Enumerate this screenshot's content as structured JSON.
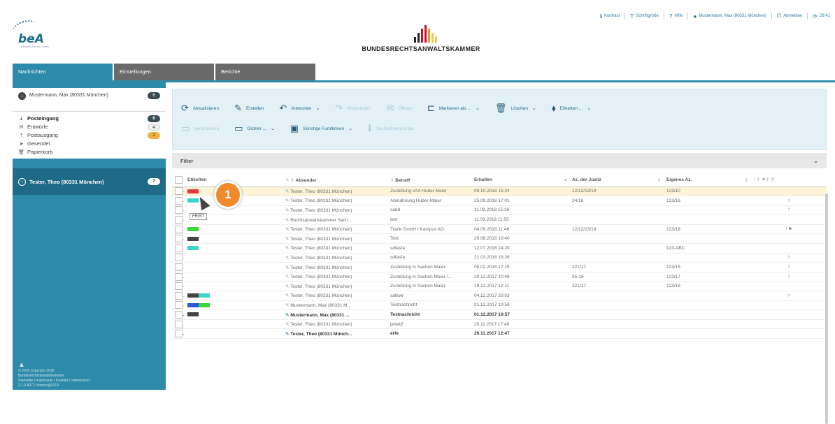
{
  "colors": {
    "accent": "#2d8aa8",
    "sidebar": "#2d8aa8",
    "highlight": "#fdf4d8",
    "marker": "#f08a2a"
  },
  "brand": {
    "logo_text": "beA",
    "logo_sub": "Beispiel Kanzlei Daten",
    "name": "BUNDESRECHTSANWALTSKAMMER"
  },
  "topbar": [
    {
      "icon": "info-icon",
      "label": "Kontrast"
    },
    {
      "icon": "font-size-icon",
      "label": "Schriftgröße"
    },
    {
      "icon": "help-icon",
      "label": "Hilfe"
    },
    {
      "icon": "user-icon",
      "label": "Mustermann, Max (80331 München)"
    },
    {
      "icon": "power-icon",
      "label": "Abmelden"
    },
    {
      "icon": "refresh-icon",
      "label": "29:41"
    }
  ],
  "tabs": [
    "Nachrichten",
    "Einstellungen",
    "Berichte"
  ],
  "sidebar": {
    "account1": {
      "name": "Mustermann, Max (80331 München)",
      "count": "6"
    },
    "folders": [
      {
        "icon": "inbox-icon",
        "label": "Posteingang",
        "count": "6"
      },
      {
        "icon": "drafts-icon",
        "label": "Entwürfe",
        "count": "4"
      },
      {
        "icon": "outbox-icon",
        "label": "Postausgang",
        "count": "1"
      },
      {
        "icon": "sent-icon",
        "label": "Gesendet",
        "count": ""
      },
      {
        "icon": "trash-icon",
        "label": "Papierkorb",
        "count": ""
      }
    ],
    "account2": {
      "name": "Tester, Theo (80331 München)",
      "count": "7"
    },
    "footer": [
      "© 2018 Copyright 2018",
      "Bundesrechtsanwaltskammer",
      "Startseite | Impressum | Kontakt | Datenschutz",
      "2.1.0.8072 Version@2019"
    ]
  },
  "toolbar": {
    "row1": [
      {
        "icon": "refresh-icon",
        "label": "Aktualisieren",
        "dropdown": false,
        "disabled": false
      },
      {
        "icon": "pencil-icon",
        "label": "Erstellen",
        "dropdown": false,
        "disabled": false
      },
      {
        "icon": "reply-icon",
        "label": "Antworten",
        "dropdown": true,
        "disabled": false
      },
      {
        "icon": "forward-icon",
        "label": "Weiterleiten",
        "dropdown": false,
        "disabled": true
      },
      {
        "icon": "envelope-icon",
        "label": "Öffnen",
        "dropdown": false,
        "disabled": true
      },
      {
        "icon": "bookmark-icon",
        "label": "Markieren als ...",
        "dropdown": true,
        "disabled": false
      },
      {
        "icon": "trash-icon",
        "label": "Löschen",
        "dropdown": true,
        "disabled": false
      },
      {
        "icon": "tag-icon",
        "label": "Etiketten ...",
        "dropdown": true,
        "disabled": false
      }
    ],
    "row2": [
      {
        "icon": "folder-move-icon",
        "label": "Verschieben",
        "dropdown": false,
        "disabled": true
      },
      {
        "icon": "folder-icon",
        "label": "Ordner ...",
        "dropdown": true,
        "disabled": false
      },
      {
        "icon": "caret-box-icon",
        "label": "Sonstige Funktionen",
        "dropdown": true,
        "disabled": false
      },
      {
        "icon": "info-icon",
        "label": "Nachrichtenjournal",
        "dropdown": false,
        "disabled": true
      }
    ]
  },
  "filter": {
    "label": "Filter"
  },
  "table": {
    "headers": [
      "Etiketten",
      "Absender",
      "Betreff",
      "Erhalten",
      "Az. der Justiz",
      "Eigenes Az.",
      ""
    ],
    "rows": [
      {
        "tags": [
          "#e23a3a"
        ],
        "sender": "Tester, Theo (80331 München)",
        "subject": "Zustellung vAA Huber Meier",
        "received": "09.10.2018 15:24",
        "az_justiz": "12/12/13/19",
        "az_own": "123/10",
        "flags": "",
        "hl": true,
        "bold": false
      },
      {
        "tags": [
          "#3ad6c8"
        ],
        "sender": "Tester, Theo (80331 München)",
        "subject": "Abmahnung Huber-Maier",
        "received": "25.09.2018 17:01",
        "az_justiz": "34/16",
        "az_own": "123/16",
        "flags": "!",
        "hl": false,
        "bold": false
      },
      {
        "tags": [],
        "sender": "Tester, Theo (80331 München)",
        "subject": "sadd",
        "received": "11.09.2018 15:36",
        "az_justiz": "",
        "az_own": "",
        "flags": "!",
        "hl": false,
        "bold": false
      },
      {
        "tags": [],
        "sender": "Rechtsanwaltskammer Sach...",
        "subject": "test",
        "received": "11.09.2018 11:55",
        "az_justiz": "",
        "az_own": "",
        "flags": "",
        "hl": false,
        "bold": false
      },
      {
        "tags": [
          "#3cd63c"
        ],
        "sender": "Tester, Theo (80331 München)",
        "subject": "Trank GmbH / Kampus AG",
        "received": "04.09.2018 11:48",
        "az_justiz": "12/12/13/18",
        "az_own": "123/18",
        "flags": "! ⚑",
        "hl": false,
        "bold": false
      },
      {
        "tags": [
          "#444444"
        ],
        "sender": "Tester, Theo (80331 München)",
        "subject": "Test",
        "received": "29.08.2018 10:40",
        "az_justiz": "",
        "az_own": "",
        "flags": "",
        "hl": false,
        "bold": false
      },
      {
        "tags": [
          "#3ad6c8"
        ],
        "sender": "Tester, Theo (80331 München)",
        "subject": "sdfasfa",
        "received": "12.07.2018 14:20",
        "az_justiz": "",
        "az_own": "123-ABC",
        "flags": "",
        "hl": false,
        "bold": false
      },
      {
        "tags": [],
        "sender": "Tester, Theo (80331 München)",
        "subject": "sdfasfa",
        "received": "21.03.2018 15:26",
        "az_justiz": "",
        "az_own": "",
        "flags": "!",
        "hl": false,
        "bold": false
      },
      {
        "tags": [],
        "sender": "Tester, Theo (80331 München)",
        "subject": "Zustellung in Sachen Maier",
        "received": "05.02.2018 17:15",
        "az_justiz": "321/17",
        "az_own": "123/15",
        "flags": "!",
        "hl": false,
        "bold": false
      },
      {
        "tags": [],
        "sender": "Tester, Theo (80331 München)",
        "subject": "Zustellung in Sachen Moier /...",
        "received": "29.12.2017 10:48",
        "az_justiz": "95-16",
        "az_own": "123/17",
        "flags": "!",
        "hl": false,
        "bold": false
      },
      {
        "tags": [],
        "sender": "Tester, Theo (80331 München)",
        "subject": "Zustellung in Sachen Maier",
        "received": "19.12.2017 12:11",
        "az_justiz": "321/17",
        "az_own": "123/18",
        "flags": "",
        "hl": false,
        "bold": false
      },
      {
        "tags": [
          "#444444",
          "#3ad6c8"
        ],
        "sender": "Tester, Theo (80331 München)",
        "subject": "safewr",
        "received": "04.12.2017 20:03",
        "az_justiz": "",
        "az_own": "",
        "flags": "!",
        "hl": false,
        "bold": false
      },
      {
        "tags": [
          "#2a5ad6",
          "#3cd63c"
        ],
        "sender": "Mustermann, Max (80331 M...",
        "subject": "Testnachricht",
        "received": "01.12.2017 10:58",
        "az_justiz": "",
        "az_own": "",
        "flags": "",
        "hl": false,
        "bold": false
      },
      {
        "tags": [
          "#444444"
        ],
        "sender": "Mustermann, Max (80331 ...",
        "subject": "Testnachricht",
        "received": "01.12.2017 10:57",
        "az_justiz": "",
        "az_own": "",
        "flags": "",
        "hl": false,
        "bold": true
      },
      {
        "tags": [],
        "sender": "Tester, Theo (80331 München)",
        "subject": "jetwkjf",
        "received": "29.11.2017 17:49",
        "az_justiz": "",
        "az_own": "",
        "flags": "",
        "hl": false,
        "bold": false
      },
      {
        "tags": [],
        "sender": "Tester, Theo (80331 Münch...",
        "subject": "erfe",
        "received": "29.11.2017 12:47",
        "az_justiz": "",
        "az_own": "",
        "flags": "",
        "hl": false,
        "bold": true
      }
    ]
  },
  "annotation": {
    "marker": "1",
    "tooltip": "FRIST"
  }
}
